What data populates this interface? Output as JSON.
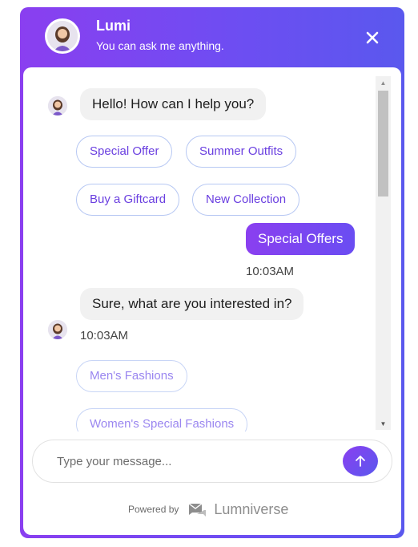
{
  "header": {
    "name": "Lumi",
    "subtitle": "You can ask me anything.",
    "close_icon": "close-icon"
  },
  "messages": {
    "greeting": "Hello! How can I help you?",
    "quick_replies_1": [
      "Special Offer",
      "Summer Outfits",
      "Buy a Giftcard",
      "New Collection"
    ],
    "user_message": "Special Offers",
    "user_time": "10:03AM",
    "bot_reply": "Sure, what are you interested in?",
    "bot_time": "10:03AM",
    "quick_replies_2": [
      "Men's Fashions",
      "Women's Special Fashions"
    ]
  },
  "composer": {
    "placeholder": "Type your message...",
    "send_icon": "arrow-up-icon"
  },
  "footer": {
    "powered_by": "Powered by",
    "brand": "Lumniverse"
  },
  "colors": {
    "accent_start": "#8a3ff0",
    "accent_end": "#5a58ee",
    "chip_text": "#6a3fe0",
    "chip_border": "#b7c8f3"
  }
}
